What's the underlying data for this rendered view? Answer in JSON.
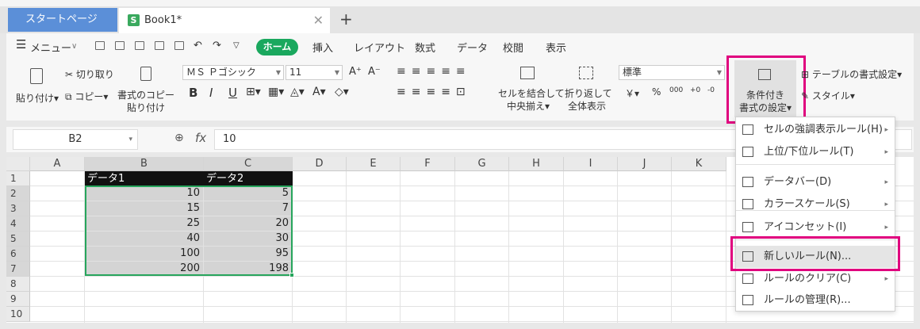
{
  "tabs": {
    "start": "スタートページ",
    "book": "Book1*",
    "close": "✕",
    "add": "+"
  },
  "menubar": {
    "menu": "メニュー",
    "items": [
      "ホーム",
      "挿入",
      "レイアウト",
      "数式",
      "データ",
      "校閲",
      "表示"
    ]
  },
  "ribbon": {
    "paste": "貼り付け",
    "cut": "切り取り",
    "copy": "コピー",
    "format_copy": [
      "書式のコピー",
      "貼り付け"
    ],
    "font_name": "ＭＳ Ｐゴシック",
    "font_size": "11",
    "bold": "B",
    "italic": "I",
    "underline": "U",
    "merge": [
      "セルを結合して",
      "中央揃え"
    ],
    "wrap": [
      "折り返して",
      "全体表示"
    ],
    "number_format": "標準",
    "percent": "%",
    "yen": "￥",
    "conditional": [
      "条件付き",
      "書式の設定"
    ],
    "table_format": "テーブルの書式設定",
    "style": "スタイル"
  },
  "formula_bar": {
    "cell_ref": "B2",
    "fx": "fx",
    "value": "10"
  },
  "grid": {
    "columns": [
      "A",
      "B",
      "C",
      "D",
      "E",
      "F",
      "G",
      "H",
      "I",
      "J",
      "K"
    ],
    "rows": [
      "1",
      "2",
      "3",
      "4",
      "5",
      "6",
      "7",
      "8",
      "9",
      "10"
    ],
    "headers": [
      "データ1",
      "データ2"
    ],
    "data": [
      [
        "10",
        "5"
      ],
      [
        "15",
        "7"
      ],
      [
        "25",
        "20"
      ],
      [
        "40",
        "30"
      ],
      [
        "100",
        "95"
      ],
      [
        "200",
        "198"
      ]
    ]
  },
  "cf_menu": {
    "items": [
      {
        "label": "セルの強調表示ルール(H)",
        "arrow": true
      },
      {
        "label": "上位/下位ルール(T)",
        "arrow": true
      },
      {
        "label": "データバー(D)",
        "arrow": true
      },
      {
        "label": "カラースケール(S)",
        "arrow": true
      },
      {
        "label": "アイコンセット(I)",
        "arrow": true
      },
      {
        "label": "新しいルール(N)...",
        "arrow": false
      },
      {
        "label": "ルールのクリア(C)",
        "arrow": true
      },
      {
        "label": "ルールの管理(R)...",
        "arrow": false
      }
    ]
  },
  "colors": {
    "accent_green": "#1aa85e",
    "highlight": "#e0007e",
    "tab_blue": "#5b8fd8",
    "selection": "#27a55c"
  }
}
